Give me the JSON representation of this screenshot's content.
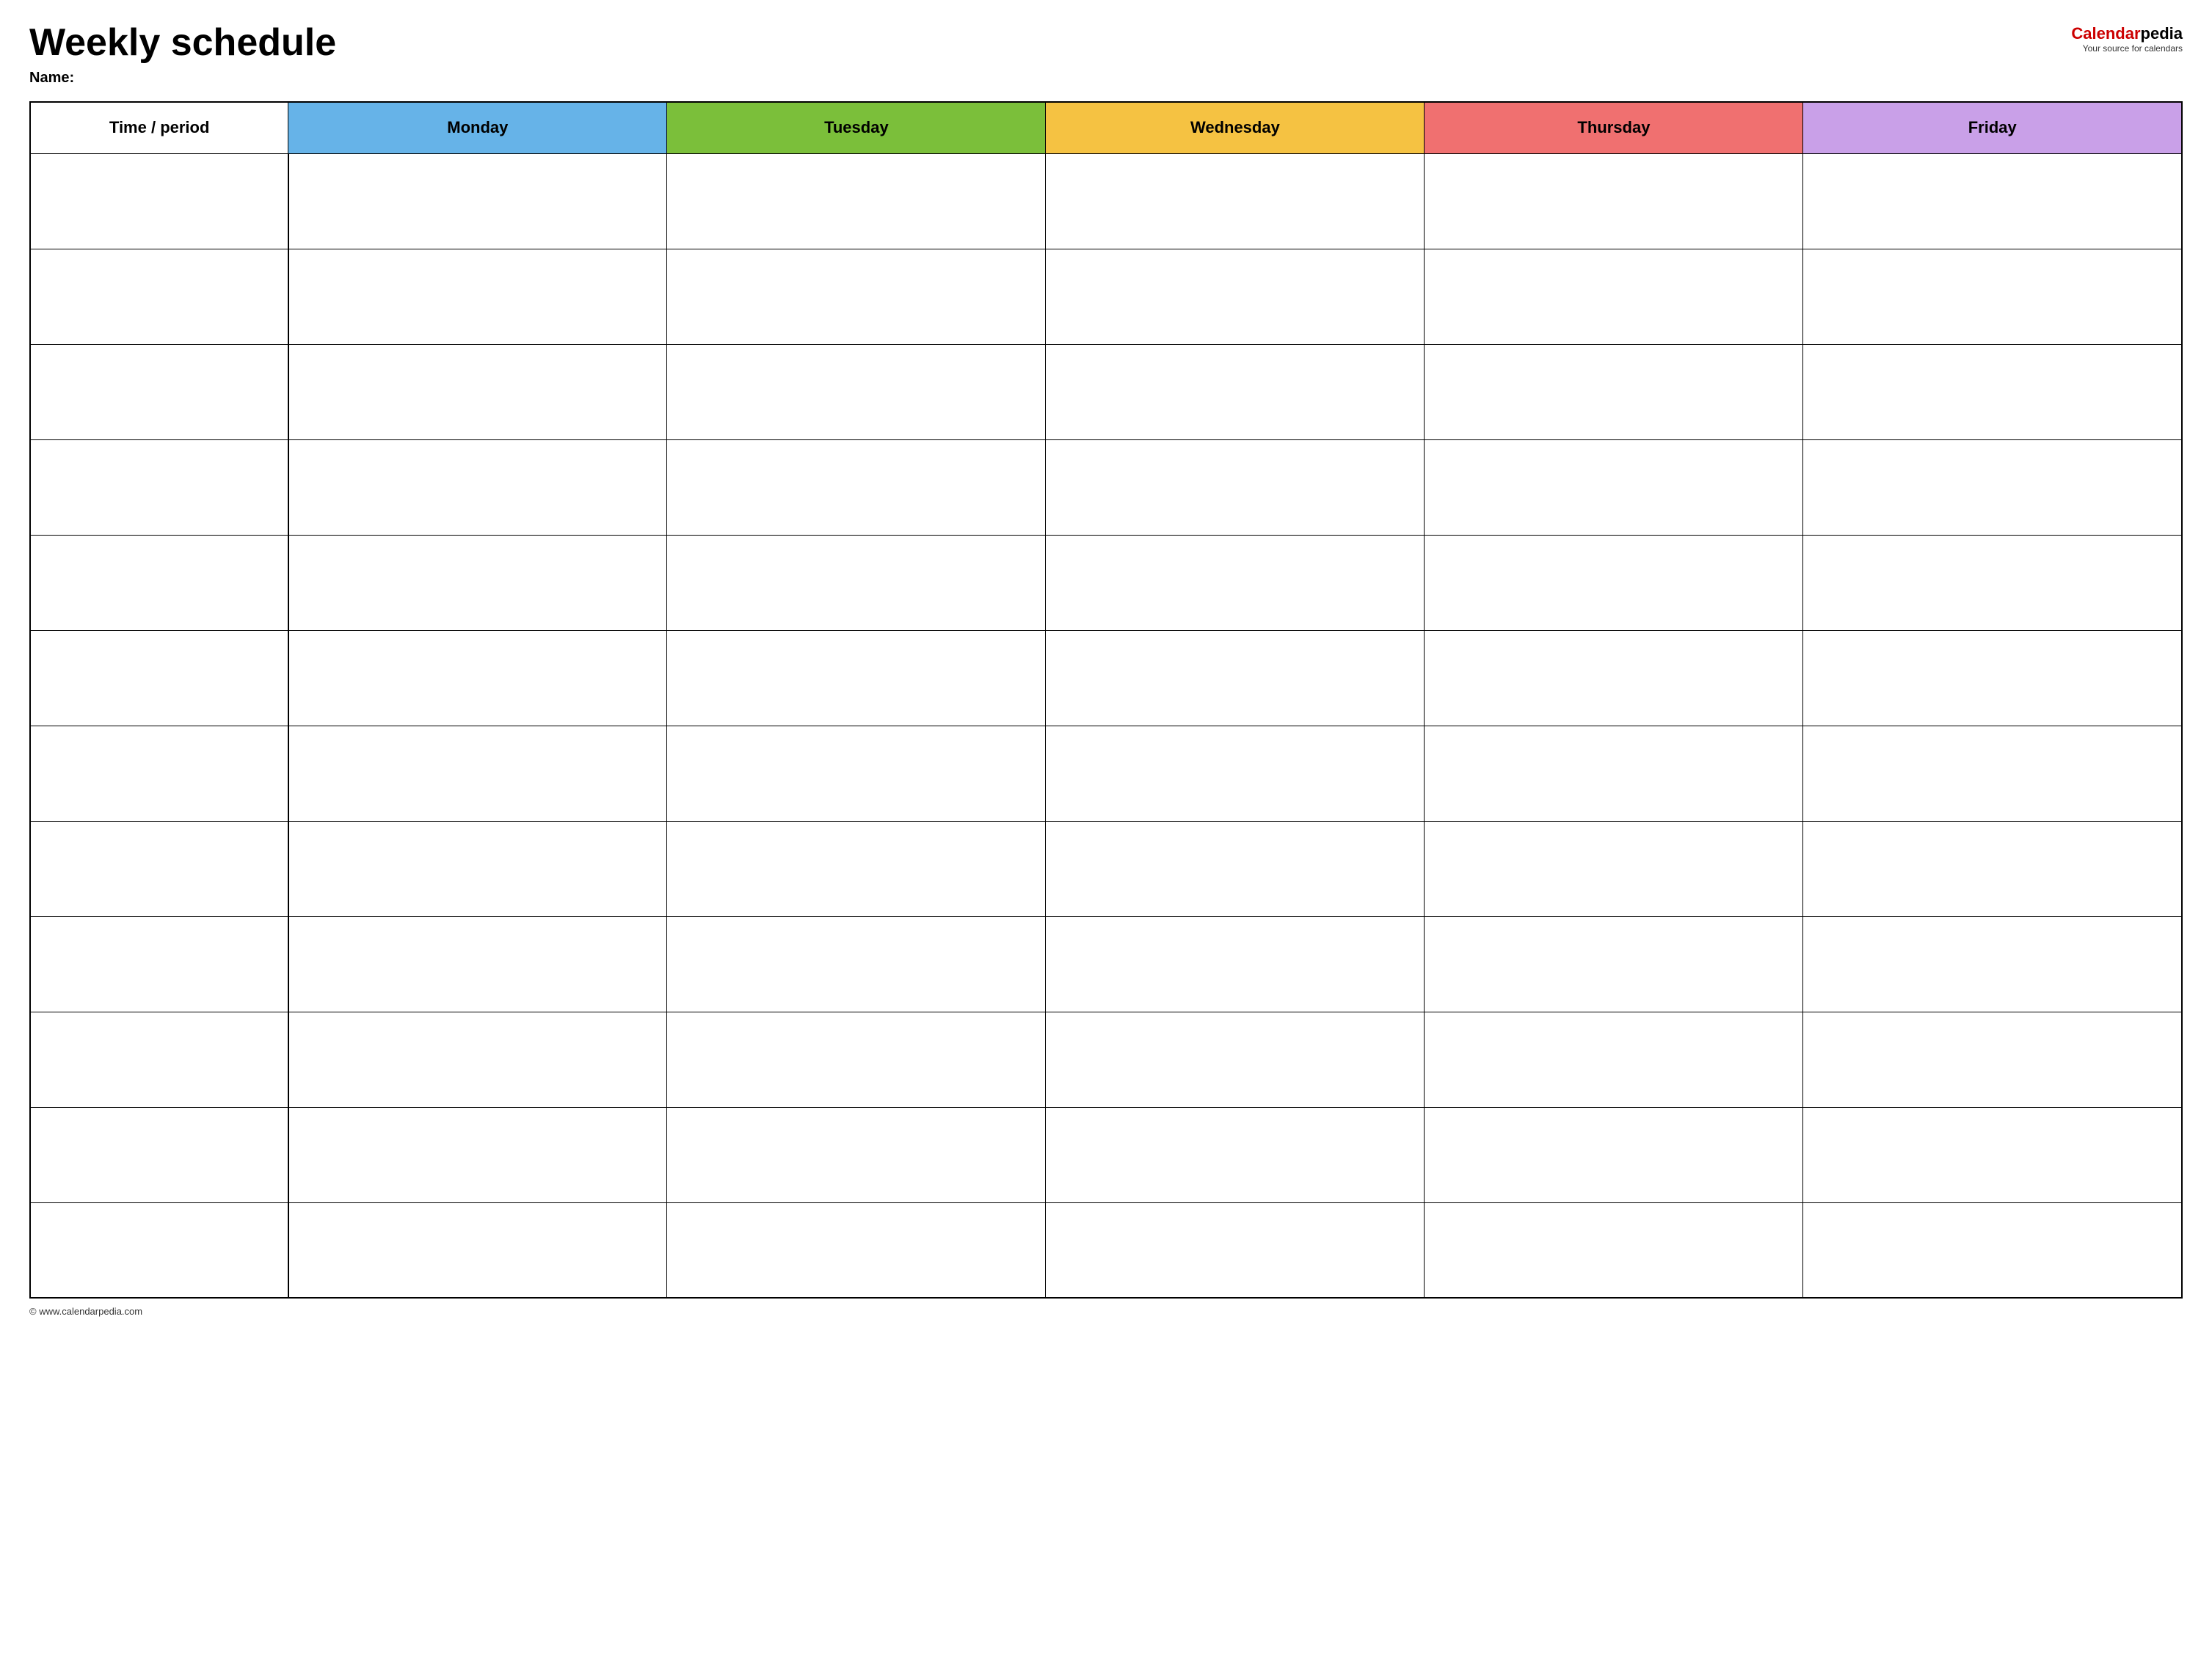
{
  "header": {
    "title": "Weekly schedule",
    "name_label": "Name:",
    "logo": {
      "calendar_text": "Calendar",
      "pedia_text": "pedia",
      "tagline": "Your source for calendars"
    }
  },
  "table": {
    "columns": [
      {
        "key": "time",
        "label": "Time / period",
        "color_class": "col-time"
      },
      {
        "key": "monday",
        "label": "Monday",
        "color_class": "col-monday"
      },
      {
        "key": "tuesday",
        "label": "Tuesday",
        "color_class": "col-tuesday"
      },
      {
        "key": "wednesday",
        "label": "Wednesday",
        "color_class": "col-wednesday"
      },
      {
        "key": "thursday",
        "label": "Thursday",
        "color_class": "col-thursday"
      },
      {
        "key": "friday",
        "label": "Friday",
        "color_class": "col-friday"
      }
    ],
    "row_count": 12
  },
  "footer": {
    "url": "© www.calendarpedia.com"
  }
}
